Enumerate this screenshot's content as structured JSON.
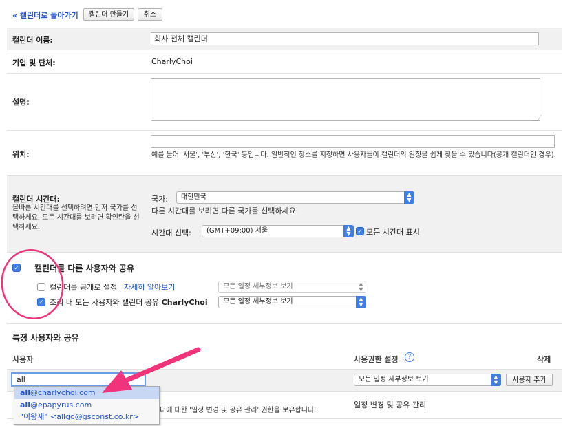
{
  "top": {
    "back_link": "« 캘린더로 돌아가기",
    "create_button": "캘린더 만들기",
    "cancel_button": "취소"
  },
  "form": {
    "name_label": "캘린더 이름:",
    "name_value": "회사 전체 캘린더",
    "org_label": "기업 및 단체:",
    "org_value": "CharlyChoi",
    "desc_label": "설명:",
    "location_label": "위치:",
    "location_hint": "예를 들어 '서울', '부산', '한국' 등입니다. 일반적인 장소를 지정하면 사용자들이 캘린더의 일정을 쉽게 찾을 수 있습니다(공개 캘린더인 경우).",
    "timezone_label": "캘린더 시간대:",
    "timezone_help": "올바른 시간대를 선택하려면 먼저 국가를 선택하세요. 모든 시간대를 보려면 확인란을 선택하세요.",
    "country_label": "국가:",
    "country_value": "대한민국",
    "country_hint": "다른 시간대를 보려면 다른 국가를 선택하세요.",
    "tz_select_label": "시간대 선택:",
    "tz_value": "(GMT+09:00) 서울",
    "show_all_tz_label": "모든 시간대 표시"
  },
  "sharing": {
    "share_label": "캘린더를 다른 사용자와 공유",
    "public_label": "캘린더를 공개로 설정",
    "learn_more": "자세히 알아보기",
    "public_select": "모든 일정 세부정보 보기",
    "org_share_label": "조직 내 모든 사용자와 캘린더 공유",
    "org_share_name": "CharlyChoi",
    "org_select": "모든 일정 세부정보 보기"
  },
  "specific": {
    "title": "특정 사용자와 공유",
    "col_user": "사용자",
    "col_perm": "사용권한 설정",
    "col_delete": "삭제",
    "user_input_value": "all",
    "perm_select": "모든 일정 세부정보 보기",
    "add_user_button": "사용자 추가",
    "owner_note_tail": "더에 대한 '일정 변경 및 공유 관리' 권한을 보유합니다.",
    "owner_perm": "일정 변경 및 공유 관리"
  },
  "autocomplete": [
    {
      "bold": "all",
      "rest": "@charlychoi.com"
    },
    {
      "bold": "all",
      "rest": "@epapyrus.com"
    },
    {
      "bold": "",
      "rest": "\"이왕재\" <allgo@gsconst.co.kr>"
    }
  ],
  "colors": {
    "accent": "#3d7fe6",
    "link": "#2255cc",
    "annotation": "#f0337a",
    "dropdown_highlight": "#c8d8f4"
  }
}
